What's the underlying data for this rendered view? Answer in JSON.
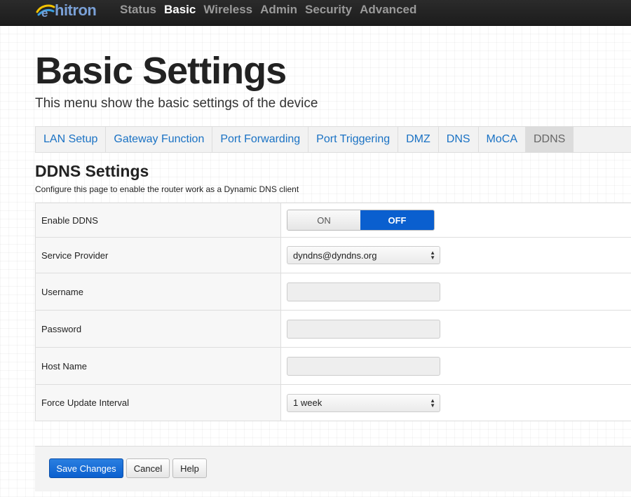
{
  "brand": {
    "name": "hitron",
    "logo_icon": "hitron-swoosh-icon"
  },
  "nav": {
    "items": [
      {
        "label": "Status",
        "active": false
      },
      {
        "label": "Basic",
        "active": true
      },
      {
        "label": "Wireless",
        "active": false
      },
      {
        "label": "Admin",
        "active": false
      },
      {
        "label": "Security",
        "active": false
      },
      {
        "label": "Advanced",
        "active": false
      }
    ]
  },
  "page": {
    "title": "Basic Settings",
    "subtitle": "This menu show the basic settings of the device"
  },
  "tabs": [
    {
      "label": "LAN Setup",
      "active": false
    },
    {
      "label": "Gateway Function",
      "active": false
    },
    {
      "label": "Port Forwarding",
      "active": false
    },
    {
      "label": "Port Triggering",
      "active": false
    },
    {
      "label": "DMZ",
      "active": false
    },
    {
      "label": "DNS",
      "active": false
    },
    {
      "label": "MoCA",
      "active": false
    },
    {
      "label": "DDNS",
      "active": true
    }
  ],
  "section": {
    "title": "DDNS Settings",
    "description": "Configure this page to enable the router work as a Dynamic DNS client"
  },
  "form": {
    "enable_ddns": {
      "label": "Enable DDNS",
      "on_label": "ON",
      "off_label": "OFF",
      "selected": "OFF"
    },
    "service_provider": {
      "label": "Service Provider",
      "value": "dyndns@dyndns.org"
    },
    "username": {
      "label": "Username",
      "value": ""
    },
    "password": {
      "label": "Password",
      "value": ""
    },
    "host_name": {
      "label": "Host Name",
      "value": ""
    },
    "force_update_interval": {
      "label": "Force Update Interval",
      "value": "1 week"
    }
  },
  "actions": {
    "save_label": "Save Changes",
    "cancel_label": "Cancel",
    "help_label": "Help"
  },
  "colors": {
    "accent": "#0a5fcf",
    "link": "#1a72c4",
    "topbar": "#222222"
  }
}
